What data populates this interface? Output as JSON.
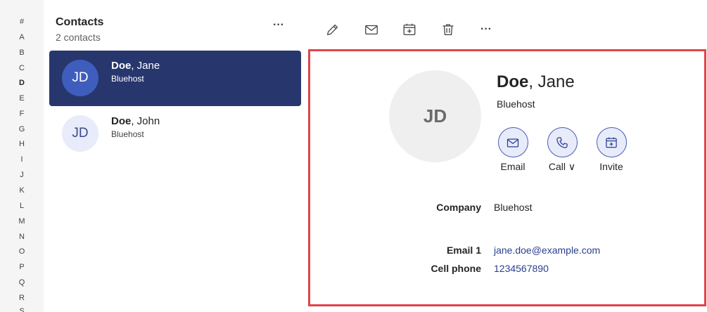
{
  "alphabet": {
    "items": [
      "#",
      "A",
      "B",
      "C",
      "D",
      "E",
      "F",
      "G",
      "H",
      "I",
      "J",
      "K",
      "L",
      "M",
      "N",
      "O",
      "P",
      "Q",
      "R",
      "S"
    ],
    "active": "D"
  },
  "list": {
    "title": "Contacts",
    "count": "2 contacts",
    "more_label": "···",
    "contacts": [
      {
        "initials": "JD",
        "last": "Doe",
        "first": ", Jane",
        "company": "Bluehost",
        "selected": true
      },
      {
        "initials": "JD",
        "last": "Doe",
        "first": ", John",
        "company": "Bluehost",
        "selected": false
      }
    ]
  },
  "toolbar": {
    "edit_icon": "pencil-icon",
    "email_icon": "mail-icon",
    "invite_icon": "calendar-add-icon",
    "delete_icon": "trash-icon",
    "more_label": "···"
  },
  "detail": {
    "initials": "JD",
    "last": "Doe",
    "first": ", Jane",
    "company": "Bluehost",
    "actions": [
      {
        "label": "Email",
        "icon": "mail-icon"
      },
      {
        "label": "Call ∨",
        "icon": "phone-icon"
      },
      {
        "label": "Invite",
        "icon": "calendar-add-icon"
      }
    ],
    "fields": {
      "company_label": "Company",
      "company_value": "Bluehost",
      "email_label": "Email 1",
      "email_value": "jane.doe@example.com",
      "phone_label": "Cell phone",
      "phone_value": "1234567890"
    }
  },
  "colors": {
    "selected_row": "#27376d",
    "selected_avatar": "#3f5dbd",
    "link": "#2a3f8f",
    "highlight_border": "#e0444b"
  }
}
